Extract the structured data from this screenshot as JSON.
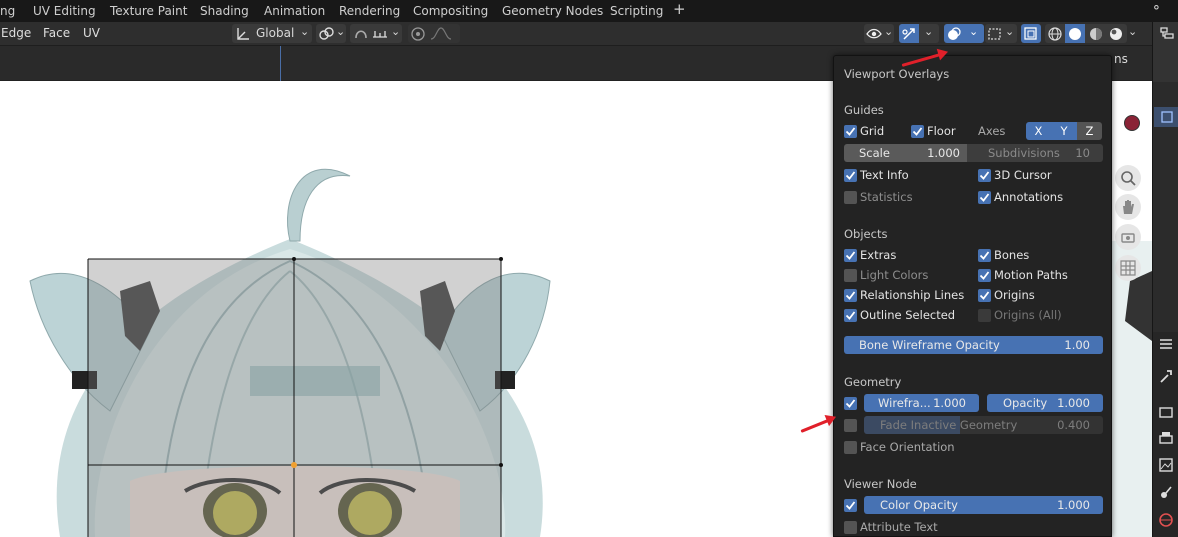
{
  "workspace_tabs": [
    "ng",
    "UV Editing",
    "Texture Paint",
    "Shading",
    "Animation",
    "Rendering",
    "Compositing",
    "Geometry Nodes",
    "Scripting"
  ],
  "header": {
    "menus": [
      "Edge",
      "Face",
      "UV"
    ],
    "orientation": "Global",
    "partial_right_text": "ns"
  },
  "overlay": {
    "title": "Viewport Overlays",
    "guides": {
      "heading": "Guides",
      "grid": "Grid",
      "floor": "Floor",
      "axes_label": "Axes",
      "axes": [
        "X",
        "Y",
        "Z"
      ],
      "scale_label": "Scale",
      "scale_value": "1.000",
      "subdivisions_label": "Subdivisions",
      "subdivisions_value": "10",
      "text_info": "Text Info",
      "cursor": "3D Cursor",
      "statistics": "Statistics",
      "annotations": "Annotations"
    },
    "objects": {
      "heading": "Objects",
      "extras": "Extras",
      "bones": "Bones",
      "light_colors": "Light Colors",
      "motion_paths": "Motion Paths",
      "relationship_lines": "Relationship Lines",
      "origins": "Origins",
      "outline_selected": "Outline Selected",
      "origins_all": "Origins (All)",
      "bone_wire_label": "Bone Wireframe Opacity",
      "bone_wire_value": "1.00"
    },
    "geometry": {
      "heading": "Geometry",
      "wireframe_label": "Wirefra...",
      "wireframe_value": "1.000",
      "opacity_label": "Opacity",
      "opacity_value": "1.000",
      "fade_label": "Fade Inactive Geometry",
      "fade_value": "0.400",
      "face_orientation": "Face Orientation"
    },
    "viewer_node": {
      "heading": "Viewer Node",
      "color_opacity_label": "Color Opacity",
      "color_opacity_value": "1.000",
      "attribute_text": "Attribute Text"
    }
  },
  "colors": {
    "accent": "#4772b3",
    "panel_bg": "#232323",
    "arrow": "#e0202a"
  }
}
